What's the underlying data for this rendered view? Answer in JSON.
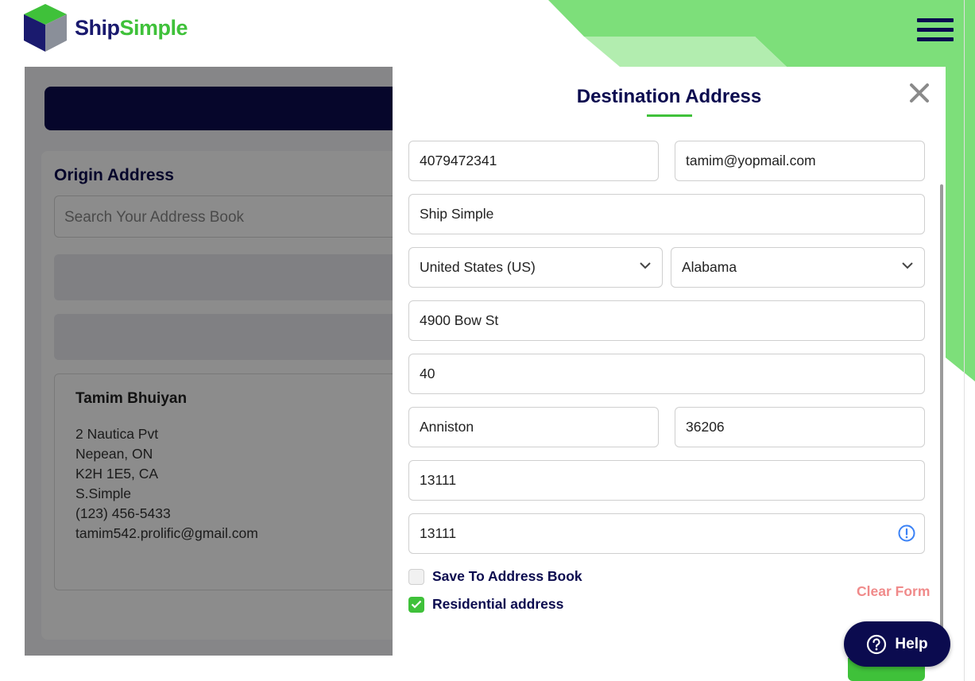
{
  "brand": {
    "ship": "Ship",
    "simple": "Simple",
    "tagline": "_____ ___ ____",
    "color_primary": "#0b0b4f",
    "color_accent": "#3fc13a"
  },
  "header": {
    "menu_icon": "hamburger-icon"
  },
  "origin": {
    "title": "Origin Address",
    "search_placeholder": "Search Your Address Book",
    "contact": {
      "name": "Tamim Bhuiyan",
      "lines": [
        "2 Nautica Pvt",
        "Nepean, ON",
        "K2H 1E5, CA",
        "S.Simple",
        "(123) 456-5433",
        "tamim542.prolific@gmail.com"
      ]
    }
  },
  "modal": {
    "title": "Destination Address",
    "close_icon": "close-icon",
    "fields": {
      "phone": "4079472341",
      "email": "tamim@yopmail.com",
      "company": "Ship Simple",
      "country": "United States (US)",
      "state": "Alabama",
      "address1": "4900 Bow St",
      "address2": "40",
      "city": "Anniston",
      "zip": "36206",
      "field7": "13111",
      "field8": "13111"
    },
    "save_to_address_book": {
      "label": "Save To Address Book",
      "checked": false
    },
    "residential": {
      "label": "Residential address",
      "checked": true
    },
    "clear_form": "Clear Form"
  },
  "help": {
    "label": "Help",
    "icon": "question-circle-icon"
  }
}
